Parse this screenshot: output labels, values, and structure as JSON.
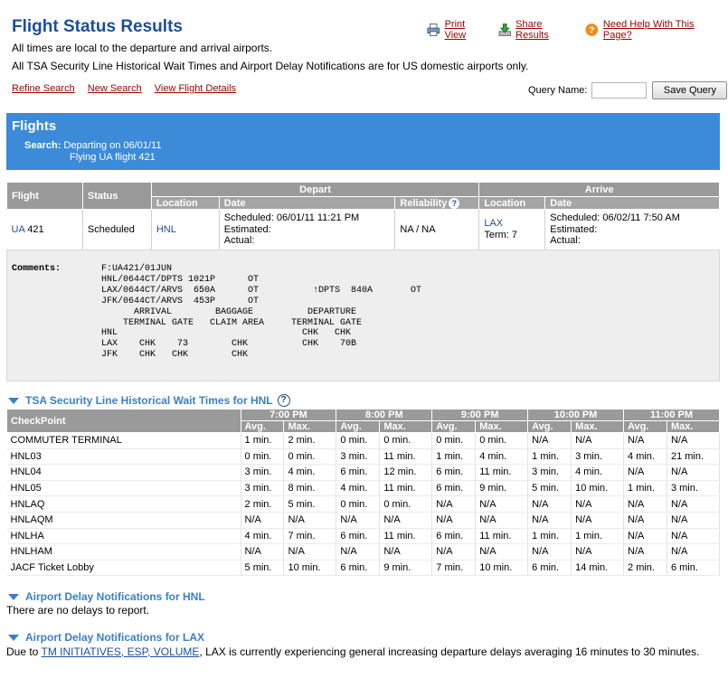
{
  "page": {
    "title": "Flight Status Results",
    "note1": "All times are local to the departure and arrival airports.",
    "note2": "All TSA Security Line Historical Wait Times and Airport Delay Notifications are for US domestic airports only."
  },
  "toplinks": {
    "print": "Print View",
    "share": "Share Results",
    "help": "Need Help With This Page?"
  },
  "nav": {
    "refine": "Refine Search",
    "new": "New Search",
    "details": "View Flight Details"
  },
  "query": {
    "label": "Query Name:",
    "value": "",
    "button": "Save Query"
  },
  "banner": {
    "heading": "Flights",
    "search_label": "Search:",
    "search_line1": "Departing on 06/01/11",
    "search_line2": "Flying UA flight 421"
  },
  "flights_table": {
    "h_flight": "Flight",
    "h_status": "Status",
    "h_depart": "Depart",
    "h_arrive": "Arrive",
    "h_location": "Location",
    "h_date": "Date",
    "h_reliability": "Reliability",
    "h_arr_location": "Location",
    "h_arr_date": "Date",
    "airline": "UA",
    "number": "421",
    "status": "Scheduled",
    "dep_airport": "HNL",
    "dep_scheduled": "Scheduled:  06/01/11 11:21 PM",
    "dep_estimated": "Estimated:",
    "dep_actual": "Actual:",
    "reliability": "NA / NA",
    "arr_airport": "LAX",
    "arr_terminal": "Term: 7",
    "arr_scheduled": "Scheduled:  06/02/11 7:50 AM",
    "arr_estimated": "Estimated:",
    "arr_actual": "Actual:"
  },
  "comments": {
    "label": "Comments:",
    "text": "F:UA421/01JUN\nHNL/0644CT/DPTS 1021P      OT\nLAX/0644CT/ARVS  650A      OT          ↑DPTS  840A       OT\nJFK/0644CT/ARVS  453P      OT\n      ARRIVAL        BAGGAGE          DEPARTURE\n    TERMINAL GATE   CLAIM AREA     TERMINAL GATE\nHNL                                  CHK   CHK\nLAX    CHK    73        CHK          CHK    70B\nJFK    CHK   CHK        CHK"
  },
  "tsa": {
    "heading": "TSA Security Line Historical Wait Times for HNL",
    "checkpoint_header": "CheckPoint",
    "times": [
      "7:00 PM",
      "8:00 PM",
      "9:00 PM",
      "10:00 PM",
      "11:00 PM"
    ],
    "avg": "Avg.",
    "max": "Max.",
    "rows": [
      {
        "name": "COMMUTER TERMINAL",
        "v": [
          "1 min.",
          "2 min.",
          "0 min.",
          "0 min.",
          "0 min.",
          "0 min.",
          "N/A",
          "N/A",
          "N/A",
          "N/A"
        ]
      },
      {
        "name": "HNL03",
        "v": [
          "0 min.",
          "0 min.",
          "3 min.",
          "11 min.",
          "1 min.",
          "4 min.",
          "1 min.",
          "3 min.",
          "4 min.",
          "21 min."
        ]
      },
      {
        "name": "HNL04",
        "v": [
          "3 min.",
          "4 min.",
          "6 min.",
          "12 min.",
          "6 min.",
          "11 min.",
          "3 min.",
          "4 min.",
          "N/A",
          "N/A"
        ]
      },
      {
        "name": "HNL05",
        "v": [
          "3 min.",
          "8 min.",
          "4 min.",
          "11 min.",
          "6 min.",
          "9 min.",
          "5 min.",
          "10 min.",
          "1 min.",
          "3 min."
        ]
      },
      {
        "name": "HNLAQ",
        "v": [
          "2 min.",
          "5 min.",
          "0 min.",
          "0 min.",
          "N/A",
          "N/A",
          "N/A",
          "N/A",
          "N/A",
          "N/A"
        ]
      },
      {
        "name": "HNLAQM",
        "v": [
          "N/A",
          "N/A",
          "N/A",
          "N/A",
          "N/A",
          "N/A",
          "N/A",
          "N/A",
          "N/A",
          "N/A"
        ]
      },
      {
        "name": "HNLHA",
        "v": [
          "4 min.",
          "7 min.",
          "6 min.",
          "11 min.",
          "6 min.",
          "11 min.",
          "1 min.",
          "1 min.",
          "N/A",
          "N/A"
        ]
      },
      {
        "name": "HNLHAM",
        "v": [
          "N/A",
          "N/A",
          "N/A",
          "N/A",
          "N/A",
          "N/A",
          "N/A",
          "N/A",
          "N/A",
          "N/A"
        ]
      },
      {
        "name": "JACF Ticket Lobby",
        "v": [
          "5 min.",
          "10 min.",
          "6 min.",
          "9 min.",
          "7 min.",
          "10 min.",
          "6 min.",
          "14 min.",
          "2 min.",
          "6 min."
        ]
      }
    ]
  },
  "delay_hnl": {
    "heading": "Airport Delay Notifications for HNL",
    "text": "There are no delays to report."
  },
  "delay_lax": {
    "heading": "Airport Delay Notifications for LAX",
    "prefix": "Due to ",
    "link": "TM INITIATIVES, ESP, VOLUME",
    "suffix": ", LAX is currently experiencing general increasing departure delays averaging 16 minutes to 30 minutes."
  },
  "colors": {
    "brand_blue": "#1a4f9c",
    "banner_blue": "#3b8bd9",
    "link_red": "#990000",
    "header_gray": "#9a9a9a"
  }
}
